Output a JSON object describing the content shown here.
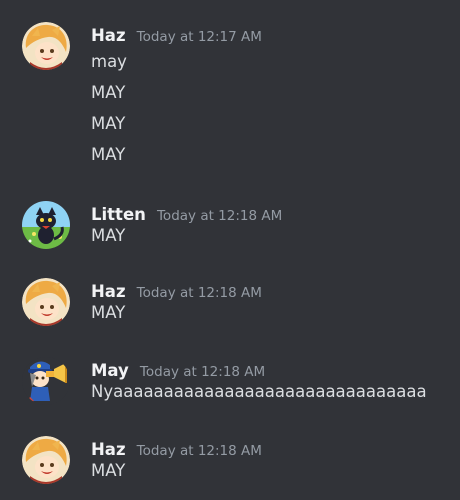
{
  "messages": [
    {
      "author": "Haz",
      "timestamp": "Today at 12:17 AM",
      "avatar": "haz-avatar",
      "lines": [
        "may",
        "MAY",
        "MAY",
        "MAY"
      ]
    },
    {
      "author": "Litten",
      "timestamp": "Today at 12:18 AM",
      "avatar": "litten-avatar",
      "lines": [
        "MAY"
      ]
    },
    {
      "author": "Haz",
      "timestamp": "Today at 12:18 AM",
      "avatar": "haz-avatar",
      "lines": [
        "MAY"
      ]
    },
    {
      "author": "May",
      "timestamp": "Today at 12:18 AM",
      "avatar": "may-avatar",
      "lines": [
        "Nyaaaaaaaaaaaaaaaaaaaaaaaaaaaaaaa"
      ]
    },
    {
      "author": "Haz",
      "timestamp": "Today at 12:18 AM",
      "avatar": "haz-avatar",
      "lines": [
        "MAY"
      ]
    }
  ],
  "colors": {
    "background": "#313338",
    "username": "#f2f3f5",
    "timestamp": "#949ba4",
    "message_text": "#dbdee1"
  }
}
